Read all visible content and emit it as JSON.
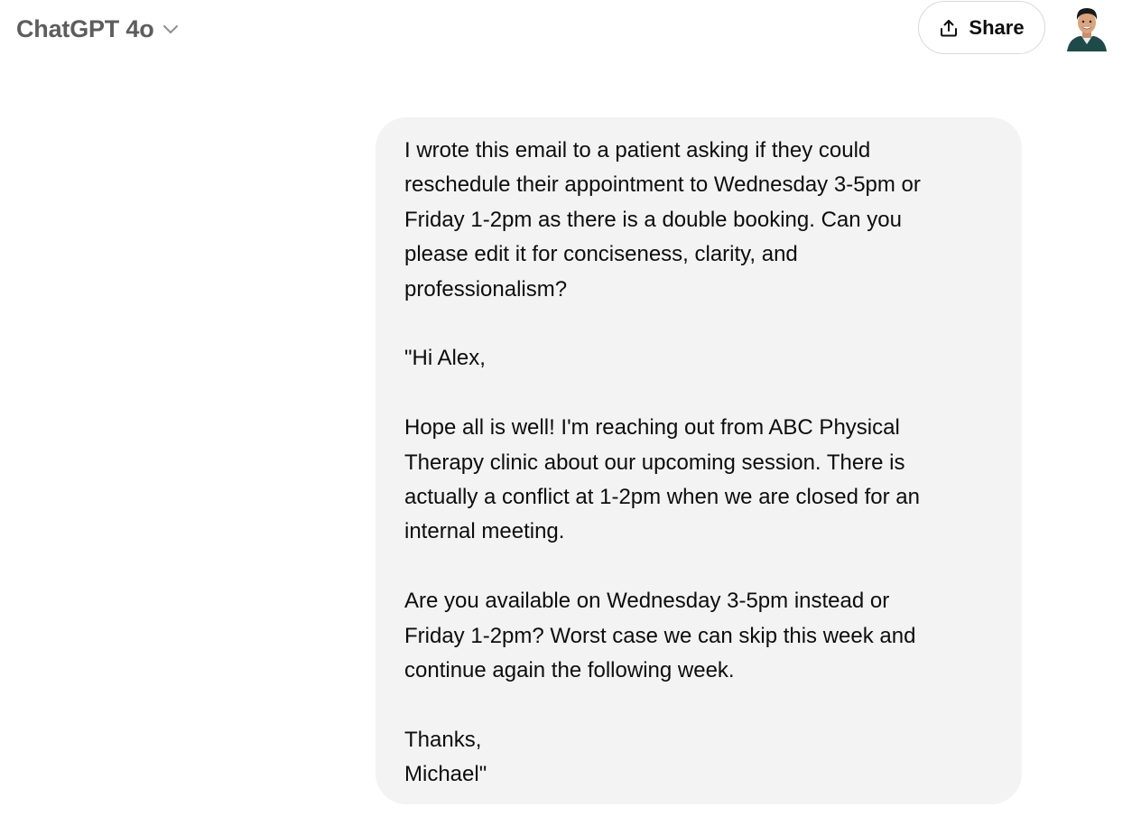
{
  "header": {
    "model_name": "ChatGPT 4o",
    "model_dropdown_icon": "chevron-down-icon",
    "share_label": "Share",
    "share_icon": "share-upload-icon",
    "avatar_icon": "user-avatar"
  },
  "conversation": {
    "user_message": {
      "intro_lines": [
        "I wrote this email to a patient asking if they could",
        "reschedule their appointment to Wednesday 3-5pm or",
        "Friday 1-2pm as there is a double booking. Can you",
        "please edit it for conciseness, clarity, and",
        "professionalism?"
      ],
      "greeting": "\"Hi Alex,",
      "body1_lines": [
        "Hope all is well! I'm reaching out from ABC Physical",
        "Therapy clinic about our upcoming session. There is",
        "actually a conflict at 1-2pm when we are closed for an",
        "internal meeting."
      ],
      "body2_lines": [
        "Are you available on Wednesday 3-5pm instead or",
        "Friday 1-2pm? Worst case we can skip this week and",
        "continue again the following week."
      ],
      "closing": "Thanks,",
      "signature": "Michael\""
    }
  },
  "colors": {
    "bubble_background": "#f3f3f3",
    "model_name_text": "#5d5d5d",
    "body_text": "#0d0d0d",
    "share_border": "#d9d9d9"
  }
}
